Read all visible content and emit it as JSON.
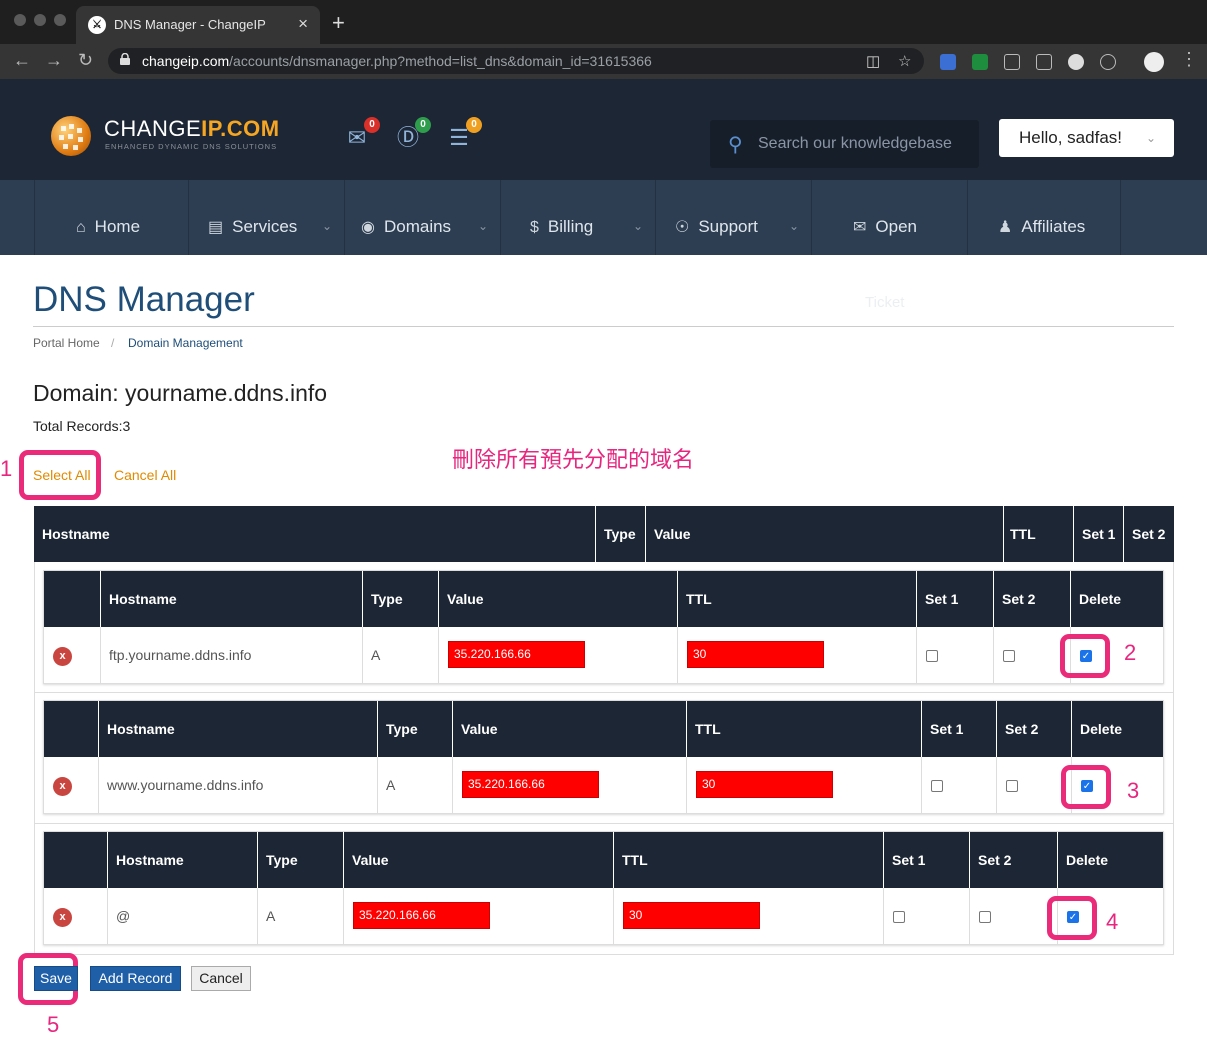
{
  "browser": {
    "tab_title": "DNS Manager - ChangeIP",
    "tab_close": "×",
    "new_tab": "+",
    "url_domain": "changeip.com",
    "url_path": "/accounts/dnsmanager.php?method=list_dns&domain_id=31615366"
  },
  "header": {
    "logo_main": "CHANGE",
    "logo_accent": "IP.COM",
    "logo_sub": "ENHANCED DYNAMIC DNS SOLUTIONS",
    "badges": {
      "messages": "0",
      "billing": "0",
      "tickets": "0"
    },
    "badge_colors": {
      "messages": "#d9302a",
      "billing": "#2e9e4c",
      "tickets": "#f0a020"
    },
    "search_placeholder": "Search our knowledgebase",
    "greeting": "Hello, sadfas!"
  },
  "nav": {
    "items": [
      {
        "label": "Home",
        "icon": "home-icon"
      },
      {
        "label": "Services",
        "icon": "list-icon"
      },
      {
        "label": "Domains",
        "icon": "binoculars-icon"
      },
      {
        "label": "Billing",
        "icon": "dollar-icon"
      },
      {
        "label": "Support",
        "icon": "lifebuoy-icon"
      },
      {
        "label": "Open",
        "icon": "envelope-icon"
      },
      {
        "label": "Affiliates",
        "icon": "user-icon"
      }
    ]
  },
  "page": {
    "title": "DNS Manager",
    "ghost_text": "Ticket",
    "breadcrumb": [
      "Portal Home",
      "Domain Management"
    ],
    "domain_heading": "Domain: yourname.ddns.info",
    "total_records": "Total Records:3",
    "annotation": "刪除所有預先分配的域名",
    "select_all": "Select All",
    "cancel_all": "Cancel All"
  },
  "table": {
    "headers": [
      "Hostname",
      "Type",
      "Value",
      "TTL",
      "Set 1",
      "Set 2"
    ],
    "record_headers": [
      "Hostname",
      "Type",
      "Value",
      "TTL",
      "Set 1",
      "Set 2",
      "Delete"
    ],
    "records": [
      {
        "hostname": "ftp.yourname.ddns.info",
        "type": "A",
        "value": "35.220.166.66",
        "ttl": "30",
        "set1": false,
        "set2": false,
        "delete": true
      },
      {
        "hostname": "www.yourname.ddns.info",
        "type": "A",
        "value": "35.220.166.66",
        "ttl": "30",
        "set1": false,
        "set2": false,
        "delete": true
      },
      {
        "hostname": "@",
        "type": "A",
        "value": "35.220.166.66",
        "ttl": "30",
        "set1": false,
        "set2": false,
        "delete": true
      }
    ]
  },
  "step_numbers": [
    "1",
    "2",
    "3",
    "4",
    "5"
  ],
  "buttons": {
    "save": "Save",
    "add_record": "Add Record",
    "cancel": "Cancel"
  }
}
